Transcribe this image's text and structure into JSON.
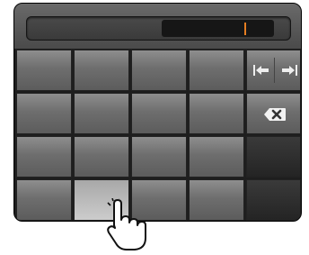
{
  "keypad": {
    "keys": {
      "move_left": {
        "icon": "move-cursor-left-icon"
      },
      "move_right": {
        "icon": "move-cursor-right-icon"
      },
      "delete": {
        "icon": "backspace-icon"
      }
    }
  },
  "pointer": {
    "icon": "pointing-hand-icon"
  },
  "colors": {
    "cursor": "#e67e22",
    "panel": "#1e1e1e",
    "pressed_key": "#c8c8c8"
  }
}
